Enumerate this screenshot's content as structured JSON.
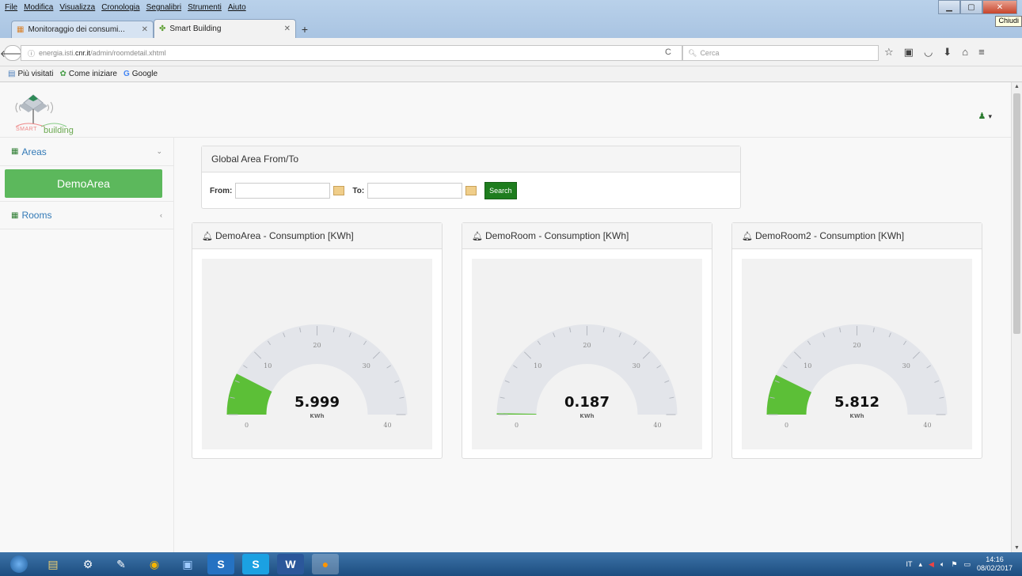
{
  "browser": {
    "menu": [
      "File",
      "Modifica",
      "Visualizza",
      "Cronologia",
      "Segnalibri",
      "Strumenti",
      "Aiuto"
    ],
    "tabs": [
      {
        "title": "Monitoraggio dei consumi...",
        "active": false
      },
      {
        "title": "Smart Building",
        "active": true
      }
    ],
    "new_tab": "+",
    "tooltip": "Chiudi",
    "url_host": "energia.isti.",
    "url_bold": "cnr.it",
    "url_path": "/admin/roomdetail.xhtml",
    "search_placeholder": "Cerca",
    "bookmarks": [
      "Più visitati",
      "Come iniziare",
      "Google"
    ]
  },
  "app": {
    "logo_small": "SMART",
    "logo_word": "building",
    "sidebar": {
      "areas_label": "Areas",
      "active_item": "DemoArea",
      "rooms_label": "Rooms"
    },
    "filter": {
      "title": "Global Area From/To",
      "from_label": "From:",
      "from_value": "",
      "to_label": "To:",
      "to_value": "",
      "search_label": "Search"
    },
    "gauges": [
      {
        "title": "DemoArea - Consumption [KWh]",
        "value": 5.999,
        "value_text": "5.999",
        "unit": "KWh"
      },
      {
        "title": "DemoRoom - Consumption [KWh]",
        "value": 0.187,
        "value_text": "0.187",
        "unit": "KWh"
      },
      {
        "title": "DemoRoom2 - Consumption [KWh]",
        "value": 5.812,
        "value_text": "5.812",
        "unit": "KWh"
      }
    ],
    "gauge_scale": {
      "min": 0,
      "max": 40,
      "labels": [
        "0",
        "10",
        "20",
        "30",
        "40"
      ]
    },
    "colors": {
      "fill": "#5cbf37",
      "track": "#e3e5ea",
      "accent": "#5cb85c",
      "button": "#1e7d1e"
    }
  },
  "taskbar": {
    "lang": "IT",
    "time": "14:16",
    "date": "08/02/2017"
  }
}
